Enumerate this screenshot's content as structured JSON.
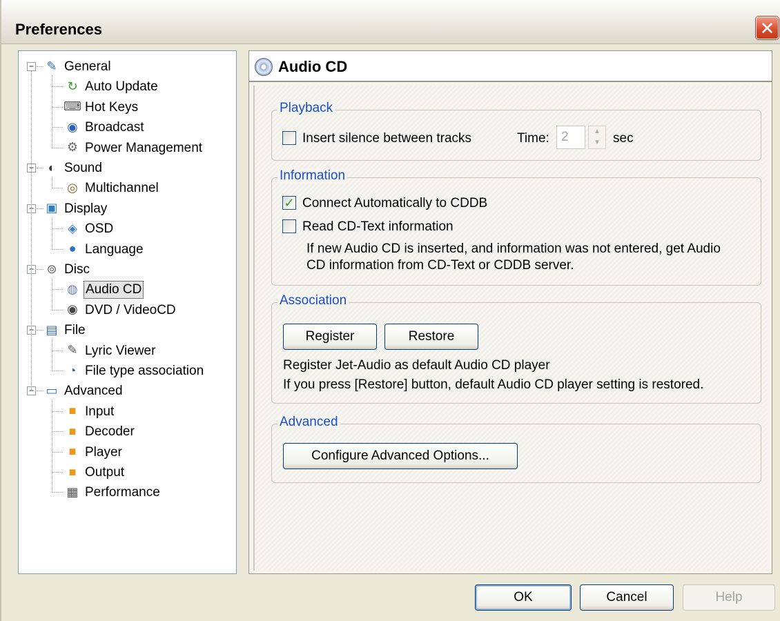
{
  "window": {
    "title": "Preferences"
  },
  "tree": [
    {
      "label": "General",
      "level": 0,
      "icon": "general-icon"
    },
    {
      "label": "Auto Update",
      "level": 1,
      "icon": "auto-update-icon"
    },
    {
      "label": "Hot Keys",
      "level": 1,
      "icon": "keyboard-icon"
    },
    {
      "label": "Broadcast",
      "level": 1,
      "icon": "broadcast-icon"
    },
    {
      "label": "Power Management",
      "level": 1,
      "icon": "power-icon"
    },
    {
      "label": "Sound",
      "level": 0,
      "icon": "sound-icon"
    },
    {
      "label": "Multichannel",
      "level": 1,
      "icon": "speakers-icon"
    },
    {
      "label": "Display",
      "level": 0,
      "icon": "display-icon"
    },
    {
      "label": "OSD",
      "level": 1,
      "icon": "osd-icon"
    },
    {
      "label": "Language",
      "level": 1,
      "icon": "globe-icon"
    },
    {
      "label": "Disc",
      "level": 0,
      "icon": "disc-drive-icon"
    },
    {
      "label": "Audio CD",
      "level": 1,
      "icon": "audio-cd-icon",
      "selected": true
    },
    {
      "label": "DVD / VideoCD",
      "level": 1,
      "icon": "dvd-icon"
    },
    {
      "label": "File",
      "level": 0,
      "icon": "file-icon"
    },
    {
      "label": "Lyric Viewer",
      "level": 1,
      "icon": "microphone-icon"
    },
    {
      "label": "File type association",
      "level": 1,
      "icon": "file-association-icon"
    },
    {
      "label": "Advanced",
      "level": 0,
      "icon": "advanced-icon"
    },
    {
      "label": "Input",
      "level": 1,
      "icon": "cube-icon"
    },
    {
      "label": "Decoder",
      "level": 1,
      "icon": "cube-icon"
    },
    {
      "label": "Player",
      "level": 1,
      "icon": "cube-icon"
    },
    {
      "label": "Output",
      "level": 1,
      "icon": "cube-icon"
    },
    {
      "label": "Performance",
      "level": 1,
      "icon": "chip-icon"
    }
  ],
  "panel": {
    "title": "Audio CD",
    "playback": {
      "legend": "Playback",
      "insert_silence_label": "Insert silence between tracks",
      "insert_silence_checked": false,
      "time_label": "Time:",
      "time_value": "2",
      "time_unit": "sec"
    },
    "information": {
      "legend": "Information",
      "connect_label": "Connect Automatically to CDDB",
      "connect_checked": true,
      "cdtext_label": "Read CD-Text information",
      "cdtext_checked": false,
      "description_line1": "If new Audio CD is inserted, and information was not entered, get Audio",
      "description_line2": "CD information from CD-Text or CDDB server."
    },
    "association": {
      "legend": "Association",
      "register_label": "Register",
      "restore_label": "Restore",
      "text_line1": "Register Jet-Audio as default Audio CD player",
      "text_line2": "If you press [Restore] button, default Audio CD player setting is restored."
    },
    "advanced": {
      "legend": "Advanced",
      "configure_label": "Configure Advanced Options..."
    }
  },
  "footer": {
    "ok_label": "OK",
    "cancel_label": "Cancel",
    "help_label": "Help"
  },
  "colors": {
    "legend_text": "#1a4ed0",
    "checkmark": "#21a121",
    "close_button": "#d9482a"
  }
}
